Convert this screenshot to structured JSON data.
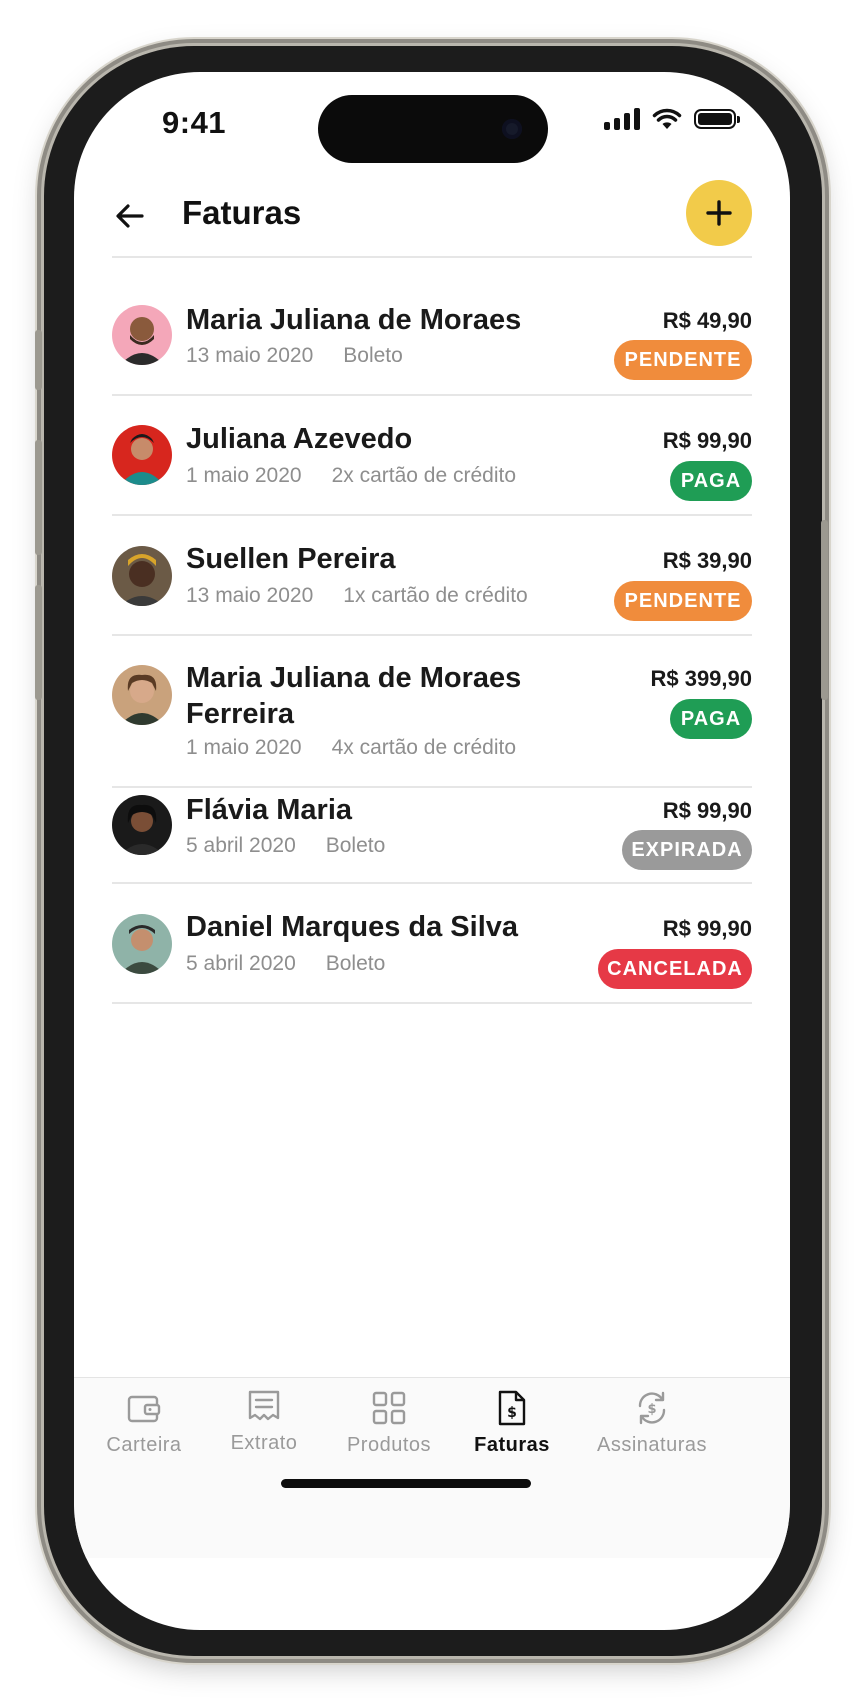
{
  "status_bar": {
    "time": "9:41"
  },
  "header": {
    "title": "Faturas",
    "add_icon": "plus-icon",
    "back_icon": "arrow-left-icon"
  },
  "invoices": [
    {
      "name": "Maria Juliana de Moraes",
      "date": "13 maio 2020",
      "method": "Boleto",
      "amount": "R$ 49,90",
      "status": "PENDENTE",
      "status_color": "#f08c3c"
    },
    {
      "name": "Juliana Azevedo",
      "date": "1 maio 2020",
      "method": "2x cartão de crédito",
      "amount": "R$ 99,90",
      "status": "PAGA",
      "status_color": "#1f9d55"
    },
    {
      "name": "Suellen Pereira",
      "date": "13 maio 2020",
      "method": "1x cartão de crédito",
      "amount": "R$ 39,90",
      "status": "PENDENTE",
      "status_color": "#f08c3c"
    },
    {
      "name": "Maria Juliana de Moraes Ferreira",
      "date": "1 maio 2020",
      "method": "4x cartão de crédito",
      "amount": "R$ 399,90",
      "status": "PAGA",
      "status_color": "#1f9d55"
    },
    {
      "name": "Flávia Maria",
      "date": "5 abril 2020",
      "method": "Boleto",
      "amount": "R$ 99,90",
      "status": "EXPIRADA",
      "status_color": "#9a9a9a"
    },
    {
      "name": "Daniel Marques da Silva",
      "date": "5 abril 2020",
      "method": "Boleto",
      "amount": "R$ 99,90",
      "status": "CANCELADA",
      "status_color": "#e63946"
    }
  ],
  "tabbar": {
    "tabs": [
      {
        "label": "Carteira",
        "icon": "wallet-icon",
        "active": false
      },
      {
        "label": "Extrato",
        "icon": "receipt-icon",
        "active": false
      },
      {
        "label": "Produtos",
        "icon": "grid-icon",
        "active": false
      },
      {
        "label": "Faturas",
        "icon": "invoice-dollar-icon",
        "active": true
      },
      {
        "label": "Assinaturas",
        "icon": "subscription-dollar-icon",
        "active": false
      }
    ]
  },
  "colors": {
    "accent_yellow": "#f2cb4a",
    "pending": "#f08c3c",
    "paid": "#1f9d55",
    "expired": "#9a9a9a",
    "cancelled": "#e63946"
  }
}
